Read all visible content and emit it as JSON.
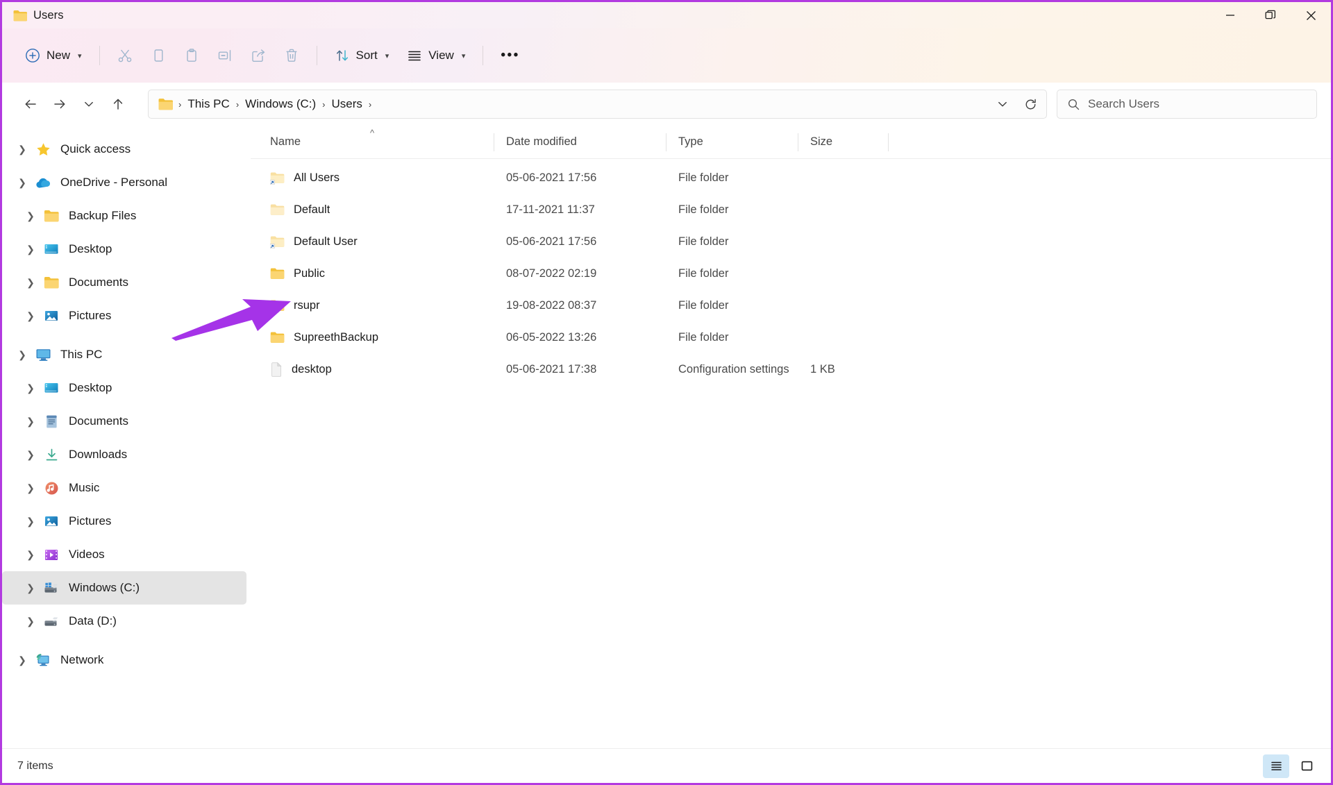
{
  "window": {
    "title": "Users",
    "title_icon": "folder-icon",
    "controls": {
      "minimize": "minimize-icon",
      "maximize": "restore-icon",
      "close": "close-icon"
    },
    "border_color": "#b23ae0"
  },
  "toolbar": {
    "new_label": "New",
    "new_icon": "plus-circle-icon",
    "cut_icon": "scissors-icon",
    "copy_icon": "copy-icon",
    "paste_icon": "clipboard-icon",
    "rename_icon": "rename-icon",
    "share_icon": "share-icon",
    "delete_icon": "trash-icon",
    "sort_label": "Sort",
    "sort_icon": "sort-arrows-icon",
    "view_label": "View",
    "view_icon": "list-lines-icon",
    "overflow_label": "•••"
  },
  "navigation": {
    "back_icon": "arrow-left-icon",
    "forward_icon": "arrow-right-icon",
    "recent_icon": "chevron-down-icon",
    "up_icon": "arrow-up-icon"
  },
  "address": {
    "folder_icon": "folder-icon",
    "crumbs": [
      "This PC",
      "Windows (C:)",
      "Users"
    ],
    "separator": "›",
    "dropdown_icon": "chevron-down-icon",
    "refresh_icon": "refresh-icon"
  },
  "search": {
    "placeholder": "Search Users",
    "icon": "search-icon",
    "value": ""
  },
  "sidebar": {
    "items": [
      {
        "label": "Quick access",
        "icon": "star-icon",
        "depth": 0,
        "twisty": "collapsed",
        "selected": false
      },
      {
        "label": "OneDrive - Personal",
        "icon": "cloud-icon",
        "depth": 0,
        "twisty": "expanded",
        "selected": false
      },
      {
        "label": "Backup Files",
        "icon": "folder-icon",
        "depth": 1,
        "twisty": "collapsed",
        "selected": false
      },
      {
        "label": "Desktop",
        "icon": "desktop-icon",
        "depth": 1,
        "twisty": "collapsed",
        "selected": false
      },
      {
        "label": "Documents",
        "icon": "folder-icon",
        "depth": 1,
        "twisty": "collapsed",
        "selected": false
      },
      {
        "label": "Pictures",
        "icon": "pictures-icon",
        "depth": 1,
        "twisty": "collapsed",
        "selected": false
      },
      {
        "label": "This PC",
        "icon": "thispc-icon",
        "depth": 0,
        "twisty": "expanded",
        "selected": false
      },
      {
        "label": "Desktop",
        "icon": "desktop-icon",
        "depth": 1,
        "twisty": "collapsed",
        "selected": false
      },
      {
        "label": "Documents",
        "icon": "document-icon",
        "depth": 1,
        "twisty": "collapsed",
        "selected": false
      },
      {
        "label": "Downloads",
        "icon": "download-icon",
        "depth": 1,
        "twisty": "collapsed",
        "selected": false
      },
      {
        "label": "Music",
        "icon": "music-icon",
        "depth": 1,
        "twisty": "collapsed",
        "selected": false
      },
      {
        "label": "Pictures",
        "icon": "pictures-icon",
        "depth": 1,
        "twisty": "collapsed",
        "selected": false
      },
      {
        "label": "Videos",
        "icon": "video-icon",
        "depth": 1,
        "twisty": "collapsed",
        "selected": false
      },
      {
        "label": "Windows (C:)",
        "icon": "windows-drive-icon",
        "depth": 1,
        "twisty": "collapsed",
        "selected": true
      },
      {
        "label": "Data (D:)",
        "icon": "drive-icon",
        "depth": 1,
        "twisty": "collapsed",
        "selected": false
      },
      {
        "label": "Network",
        "icon": "network-icon",
        "depth": 0,
        "twisty": "collapsed",
        "selected": false
      }
    ]
  },
  "filelist": {
    "columns": [
      {
        "key": "name",
        "label": "Name",
        "sorted": "asc"
      },
      {
        "key": "date",
        "label": "Date modified",
        "sorted": ""
      },
      {
        "key": "type",
        "label": "Type",
        "sorted": ""
      },
      {
        "key": "size",
        "label": "Size",
        "sorted": ""
      }
    ],
    "rows": [
      {
        "name": "All Users",
        "date": "05-06-2021 17:56",
        "type": "File folder",
        "size": "",
        "icon": "folder-shortcut-icon"
      },
      {
        "name": "Default",
        "date": "17-11-2021 11:37",
        "type": "File folder",
        "size": "",
        "icon": "folder-hidden-icon"
      },
      {
        "name": "Default User",
        "date": "05-06-2021 17:56",
        "type": "File folder",
        "size": "",
        "icon": "folder-shortcut-icon"
      },
      {
        "name": "Public",
        "date": "08-07-2022 02:19",
        "type": "File folder",
        "size": "",
        "icon": "folder-icon"
      },
      {
        "name": "rsupr",
        "date": "19-08-2022 08:37",
        "type": "File folder",
        "size": "",
        "icon": "folder-icon"
      },
      {
        "name": "SupreethBackup",
        "date": "06-05-2022 13:26",
        "type": "File folder",
        "size": "",
        "icon": "folder-icon"
      },
      {
        "name": "desktop",
        "date": "05-06-2021 17:38",
        "type": "Configuration settings",
        "size": "1 KB",
        "icon": "config-file-icon"
      }
    ]
  },
  "statusbar": {
    "item_count": "7 items",
    "details_view_icon": "details-view-icon",
    "large_icons_view_icon": "large-icons-view-icon",
    "active_view": "details"
  },
  "annotation": {
    "arrow_color": "#a533e8",
    "points_to": "rsupr"
  }
}
